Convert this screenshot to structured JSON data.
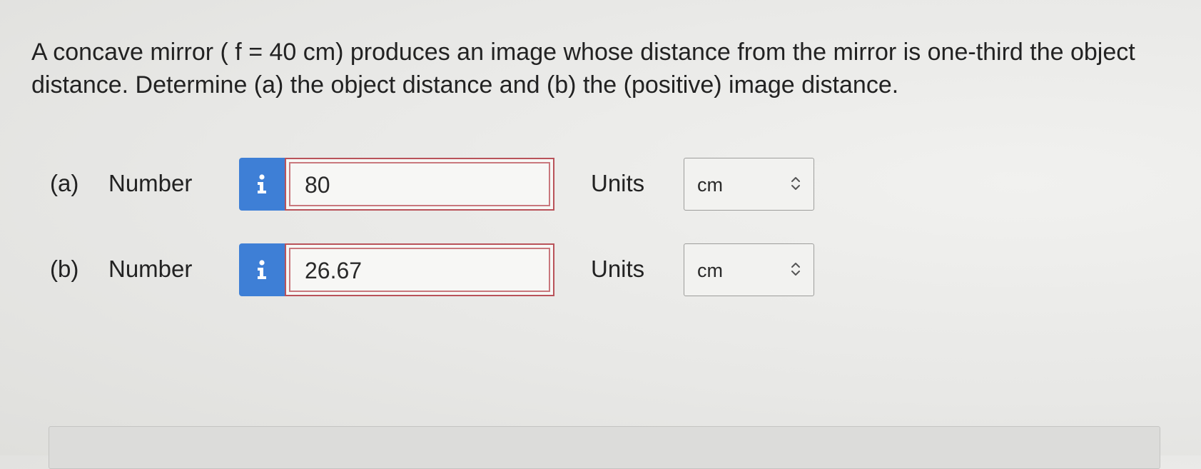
{
  "question": {
    "text": "A concave mirror ( f = 40 cm) produces an image whose distance from the mirror is one-third the object distance. Determine (a) the object distance and (b) the (positive) image distance."
  },
  "parts": [
    {
      "part_label": "(a)",
      "number_label": "Number",
      "info_icon": "info-icon",
      "answer_value": "80",
      "units_label": "Units",
      "units_selected": "cm"
    },
    {
      "part_label": "(b)",
      "number_label": "Number",
      "info_icon": "info-icon",
      "answer_value": "26.67",
      "units_label": "Units",
      "units_selected": "cm"
    }
  ],
  "colors": {
    "info_button": "#3e7fd6",
    "answer_border_incorrect": "#b9535a",
    "page_background": "#e9e9e7"
  }
}
